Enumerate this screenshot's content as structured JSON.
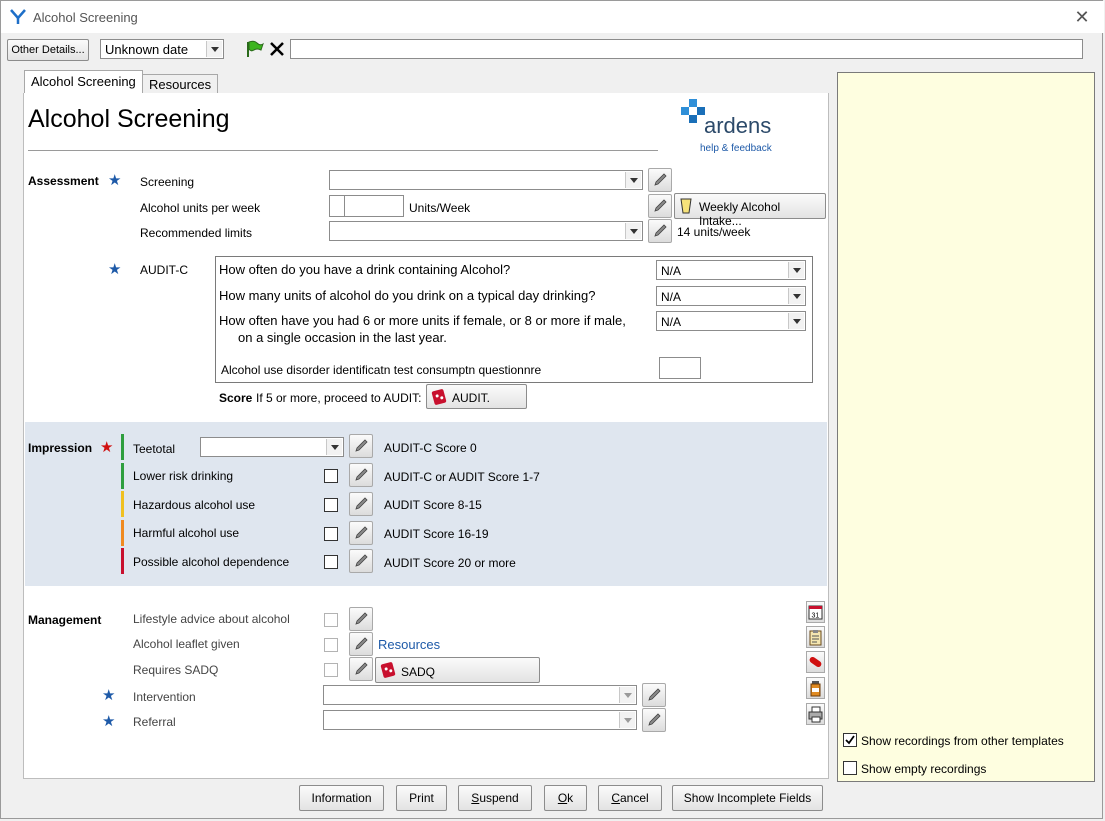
{
  "window": {
    "title": "Alcohol Screening"
  },
  "toolbar": {
    "other_details_label": "Other Details...",
    "date_value": "Unknown date",
    "free_text_value": ""
  },
  "tabs": [
    {
      "label": "Alcohol Screening",
      "active": true
    },
    {
      "label": "Resources",
      "active": false
    }
  ],
  "form": {
    "heading": "Alcohol Screening",
    "logo": {
      "name": "ardens",
      "link": "help & feedback"
    },
    "assessment": {
      "section_label": "Assessment",
      "screening": {
        "label": "Screening",
        "value": ""
      },
      "units": {
        "label": "Alcohol units per week",
        "unit": "Units/Week",
        "value": "",
        "weekly_button": "Weekly Alcohol Intake..."
      },
      "limits": {
        "label": "Recommended limits",
        "value": "",
        "note": "14 units/week"
      },
      "auditc": {
        "label": "AUDIT-C",
        "questions": [
          {
            "text": "How often do you have a drink containing Alcohol?",
            "value": "N/A"
          },
          {
            "text": "How many units of alcohol do you drink on a typical day drinking?",
            "value": "N/A"
          },
          {
            "text": "How often have you had 6 or more units if female, or 8 or more if male,",
            "text2": "on a single occasion in the last year.",
            "value": "N/A"
          }
        ],
        "questionnaire_label": "Alcohol use disorder identificatn test consumptn questionnre",
        "questionnaire_value": "",
        "score_label": "Score",
        "score_note": "If 5 or more, proceed to AUDIT:",
        "audit_button": "AUDIT."
      }
    },
    "impression": {
      "section_label": "Impression",
      "items": [
        {
          "label": "Teetotal",
          "note": "AUDIT-C Score 0",
          "color": "#2e9e3e",
          "type": "combo",
          "value": ""
        },
        {
          "label": "Lower risk drinking",
          "note": "AUDIT-C or AUDIT Score 1-7",
          "color": "#2e9e3e",
          "type": "check"
        },
        {
          "label": "Hazardous alcohol use",
          "note": "AUDIT Score 8-15",
          "color": "#f0c020",
          "type": "check"
        },
        {
          "label": "Harmful alcohol use",
          "note": "AUDIT Score 16-19",
          "color": "#f08a20",
          "type": "check"
        },
        {
          "label": "Possible alcohol dependence",
          "note": "AUDIT Score 20 or more",
          "color": "#c8102e",
          "type": "check"
        }
      ]
    },
    "management": {
      "section_label": "Management",
      "items": [
        {
          "label": "Lifestyle advice about alcohol"
        },
        {
          "label": "Alcohol leaflet given",
          "link": "Resources"
        },
        {
          "label": "Requires SADQ",
          "button": "SADQ"
        }
      ],
      "intervention": {
        "label": "Intervention",
        "value": ""
      },
      "referral": {
        "label": "Referral",
        "value": ""
      }
    }
  },
  "side_icons": [
    "calendar-icon",
    "clipboard-icon",
    "pill-icon",
    "medicine-bottle-icon",
    "printer-icon"
  ],
  "right_panel": {
    "show_other_templates": {
      "label": "Show recordings from other templates",
      "checked": true
    },
    "show_empty": {
      "label": "Show empty recordings",
      "checked": false
    }
  },
  "footer": {
    "information": "Information",
    "print": "Print",
    "suspend": "Suspend",
    "ok": "Ok",
    "cancel": "Cancel",
    "show_incomplete": "Show Incomplete Fields"
  },
  "colors": {
    "accent_blue": "#1e5aa8",
    "star_blue": "#1e5aa8",
    "star_red": "#d01010",
    "panel_yellow": "#fefee0",
    "band_blue": "#dfe6ef"
  }
}
